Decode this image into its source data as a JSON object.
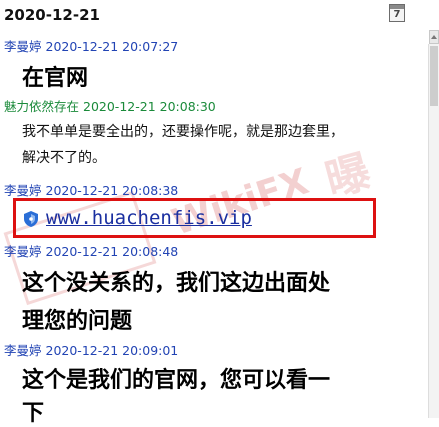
{
  "header": {
    "date": "2020-12-21",
    "calendar_number": "7"
  },
  "messages": [
    {
      "sender": "李曼婷",
      "time": "2020-12-21 20:07:27",
      "lines": [
        "在官网"
      ]
    },
    {
      "sender": "魅力依然存在",
      "time": "2020-12-21 20:08:30",
      "lines": [
        "我不单单是要全出的，还要操作呢，就是那边套里，",
        "解决不了的。"
      ]
    },
    {
      "sender": "李曼婷",
      "time": "2020-12-21 20:08:38",
      "link": "www.huachenfis.vip"
    },
    {
      "sender": "李曼婷",
      "time": "2020-12-21 20:08:48",
      "lines": [
        "这个没关系的，我们这边出面处",
        "理您的问题"
      ]
    },
    {
      "sender": "李曼婷",
      "time": "2020-12-21 20:09:01",
      "lines": [
        "这个是我们的官网，您可以看一",
        "下"
      ]
    }
  ],
  "watermark": {
    "text": "WikiFX",
    "cn": "曝"
  },
  "colors": {
    "sender_blue": "#2244b4",
    "sender_green": "#1a8a3a",
    "link": "#1a2fa0",
    "highlight_box": "#dd1111"
  }
}
